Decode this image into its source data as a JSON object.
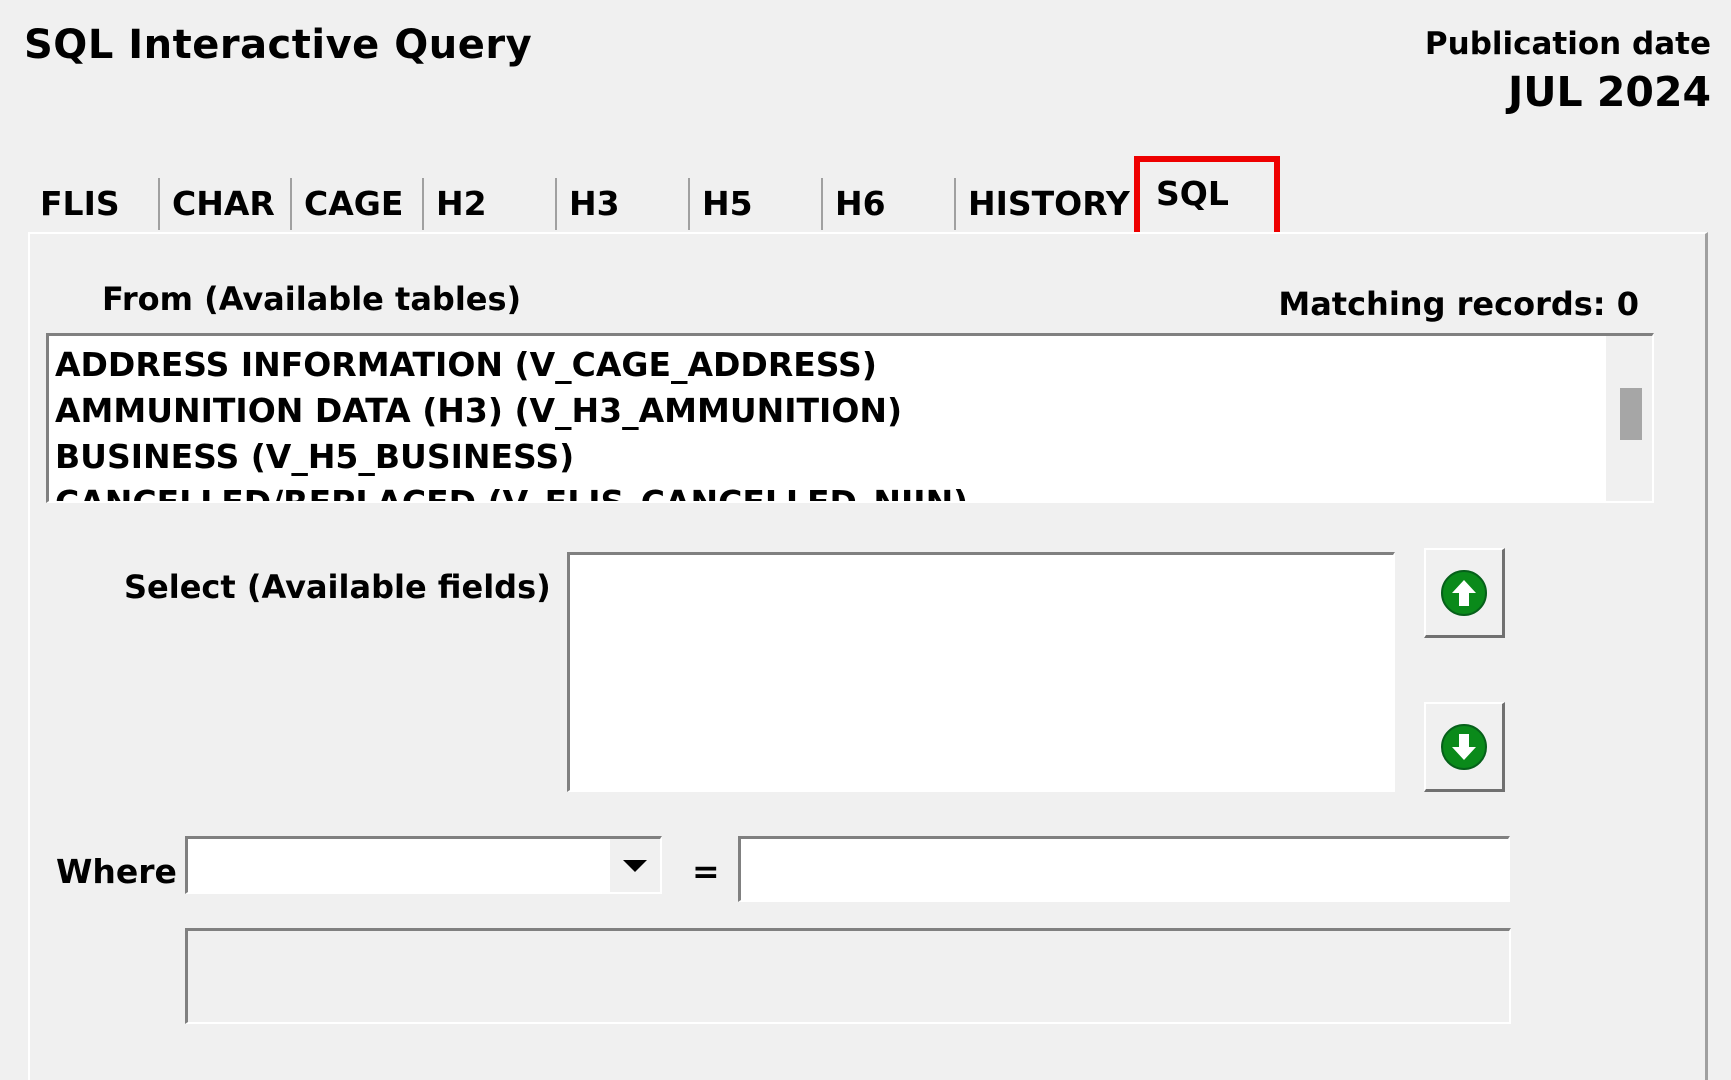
{
  "window": {
    "title": "SQL Interactive Query",
    "publication_label": "Publication date",
    "publication_date": "JUL 2024"
  },
  "tabs": [
    {
      "label": "FLIS"
    },
    {
      "label": "CHAR"
    },
    {
      "label": "CAGE"
    },
    {
      "label": "H2"
    },
    {
      "label": "H3"
    },
    {
      "label": "H5"
    },
    {
      "label": "H6"
    },
    {
      "label": "HISTORY"
    },
    {
      "label": "SQL",
      "active": true
    }
  ],
  "from": {
    "label": "From (Available tables)",
    "matching_records": "Matching records: 0",
    "tables": [
      "ADDRESS INFORMATION (V_CAGE_ADDRESS)",
      "AMMUNITION DATA (H3) (V_H3_AMMUNITION)",
      "BUSINESS (V_H5_BUSINESS)",
      "CANCELLED/REPLACED (V_FLIS_CANCELLED_NIIN)"
    ]
  },
  "select": {
    "label": "Select (Available fields)",
    "fields": []
  },
  "where": {
    "label": "Where",
    "field_value": "",
    "equals": "=",
    "value": "",
    "sql_text": ""
  },
  "icons": {
    "move_up": "arrow-up-circle-icon",
    "move_down": "arrow-down-circle-icon",
    "dropdown": "chevron-down-icon"
  },
  "colors": {
    "background": "#f0f0f0",
    "highlight_red": "#ee0000",
    "arrow_green": "#0a8a1a"
  }
}
